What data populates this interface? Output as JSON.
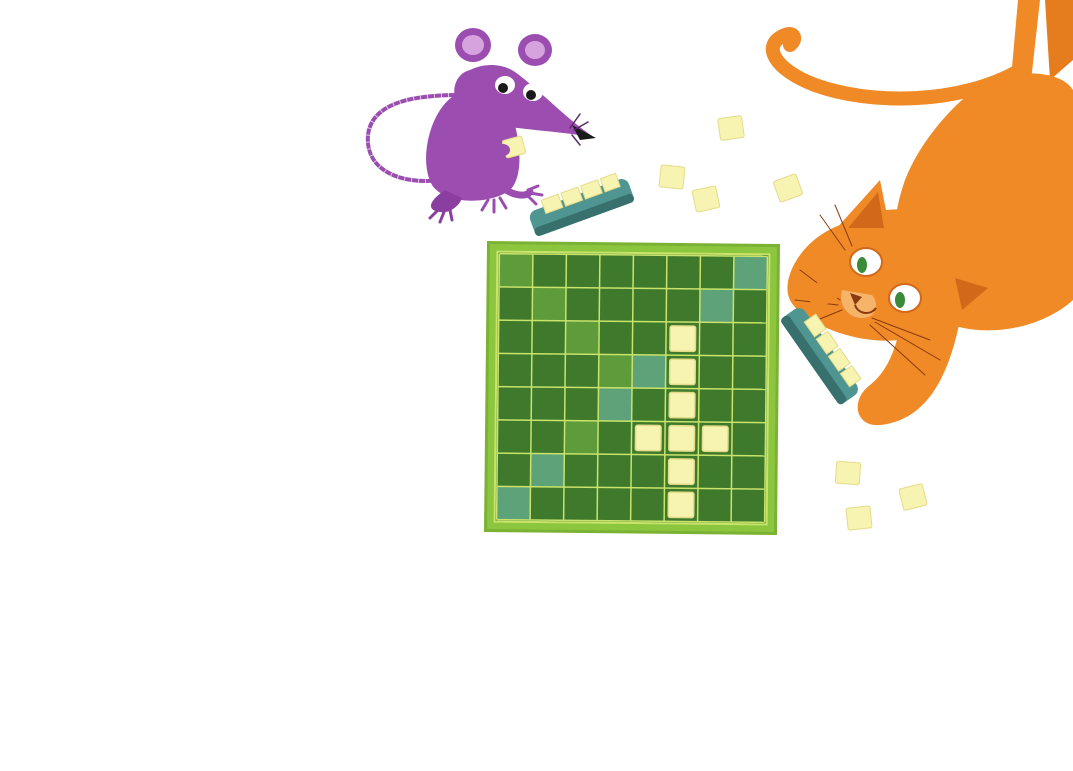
{
  "scene": {
    "description_label": "",
    "board": {
      "rows": 8,
      "cols": 8,
      "frame_color": "#8cc63f",
      "cell_dark": "#3f7a2c",
      "cell_mid": "#5e9b3b",
      "cell_teal": "#5ea27a",
      "grid_line": "#c9e36b",
      "tiles_on_board": [
        {
          "row": 2,
          "col": 5
        },
        {
          "row": 3,
          "col": 5
        },
        {
          "row": 4,
          "col": 5
        },
        {
          "row": 5,
          "col": 4
        },
        {
          "row": 5,
          "col": 5
        },
        {
          "row": 5,
          "col": 6
        },
        {
          "row": 6,
          "col": 5
        },
        {
          "row": 7,
          "col": 5
        }
      ],
      "highlight_cells": [
        {
          "row": 0,
          "col": 7,
          "tone": "teal"
        },
        {
          "row": 1,
          "col": 1,
          "tone": "mid"
        },
        {
          "row": 1,
          "col": 6,
          "tone": "teal"
        },
        {
          "row": 2,
          "col": 2,
          "tone": "mid"
        },
        {
          "row": 3,
          "col": 3,
          "tone": "mid"
        },
        {
          "row": 3,
          "col": 4,
          "tone": "teal"
        },
        {
          "row": 4,
          "col": 3,
          "tone": "teal"
        },
        {
          "row": 5,
          "col": 2,
          "tone": "mid"
        },
        {
          "row": 6,
          "col": 1,
          "tone": "teal"
        },
        {
          "row": 7,
          "col": 0,
          "tone": "teal"
        },
        {
          "row": 0,
          "col": 0,
          "tone": "mid"
        }
      ]
    },
    "colors": {
      "tile": "#f7f3b0",
      "tile_edge": "#e3dc8a",
      "rack": "#4f9592",
      "rack_dark": "#37706d",
      "mouse": "#9b4db0",
      "mouse_dark": "#6f2f85",
      "mouse_ear": "#d6a3df",
      "cat": "#f08a26",
      "cat_dark": "#d2691a",
      "cat_light": "#f6b46a",
      "eye_green": "#3a8a3a"
    },
    "icons": {
      "mouse": "mouse-character",
      "cat": "cat-character",
      "board": "game-board",
      "tile": "letter-tile",
      "rack": "tile-rack"
    }
  }
}
